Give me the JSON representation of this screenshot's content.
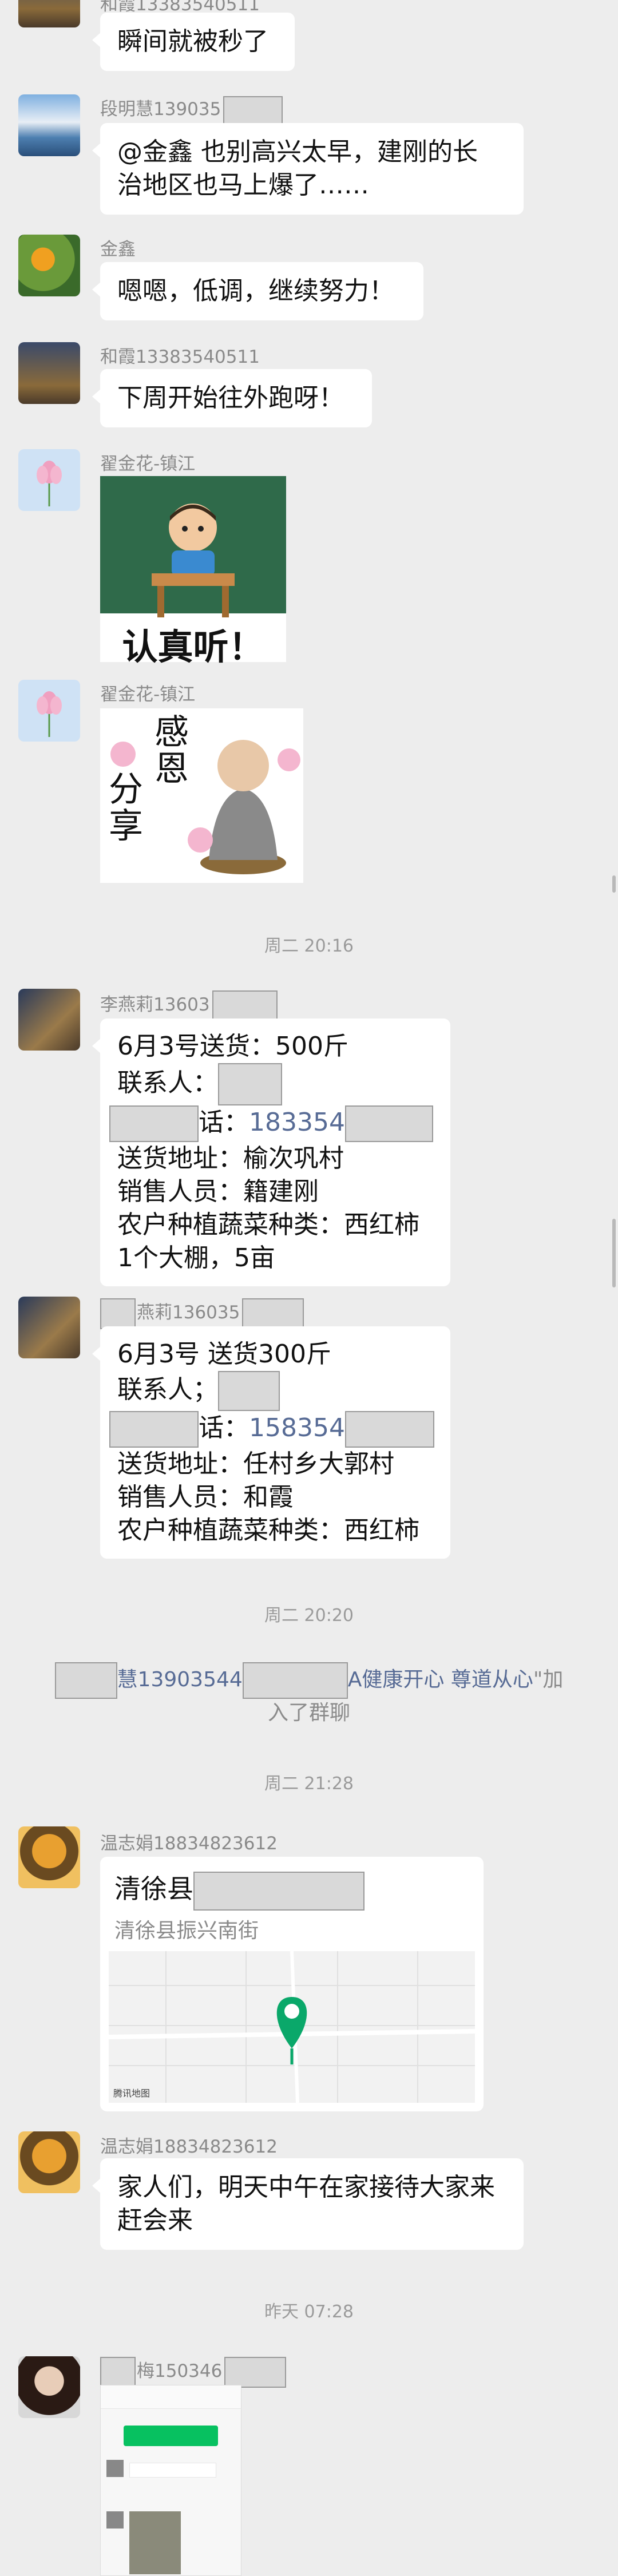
{
  "messages": {
    "m1": {
      "sender": "和霞13383540511",
      "text": "瞬间就被秒了"
    },
    "m2": {
      "sender": "段明慧139035",
      "text_l1": "@金鑫  也别高兴太早，建刚的长",
      "text_l2": "治地区也马上爆了……"
    },
    "m3": {
      "sender": "金鑫",
      "text": "嗯嗯，低调，继续努力！"
    },
    "m4": {
      "sender": "和霞13383540511",
      "text": "下周开始往外跑呀！"
    },
    "m5": {
      "sender": "翟金花-镇江",
      "sticker_text": "认真听！"
    },
    "m6": {
      "sender": "翟金花-镇江",
      "sticker_text_1": "感恩",
      "sticker_text_2": "分享"
    },
    "m7": {
      "sender": "李燕莉13603",
      "l1": "6月3号送货：500斤",
      "l2": "联系人：",
      "l3_suffix": "话：",
      "l3_phone": "183354",
      "l4": "送货地址：榆次巩村",
      "l5": "销售人员：籍建刚",
      "l6": "农户种植蔬菜种类：西红柿",
      "l7": "1个大棚，5亩"
    },
    "m8": {
      "sender": "燕莉136035",
      "l1": "6月3号  送货300斤",
      "l2": "联系人；",
      "l3_suffix": "话：",
      "l3_phone": "158354",
      "l4": "送货地址：任村乡大郭村",
      "l5": "销售人员：和霞",
      "l6": "农户种植蔬菜种类：西红柿"
    },
    "m9": {
      "sender": "温志娟18834823612",
      "loc_title": "清徐县",
      "loc_addr": "清徐县振兴南街",
      "map_brand": "腾讯地图"
    },
    "m10": {
      "sender": "温志娟18834823612",
      "text_l1": "家人们，明天中午在家接待大家来",
      "text_l2": "赶会来"
    },
    "m11": {
      "sender": "梅150346"
    }
  },
  "timestamps": {
    "t1": "周二 20:16",
    "t2": "周二 20:20",
    "t3": "周二 21:28",
    "t4": "昨天 07:28"
  },
  "system": {
    "prefix": "慧13903544",
    "names": "A健康开心   尊道从心",
    "suffix_l1": "\"加",
    "suffix_l2": "入了群聊"
  }
}
